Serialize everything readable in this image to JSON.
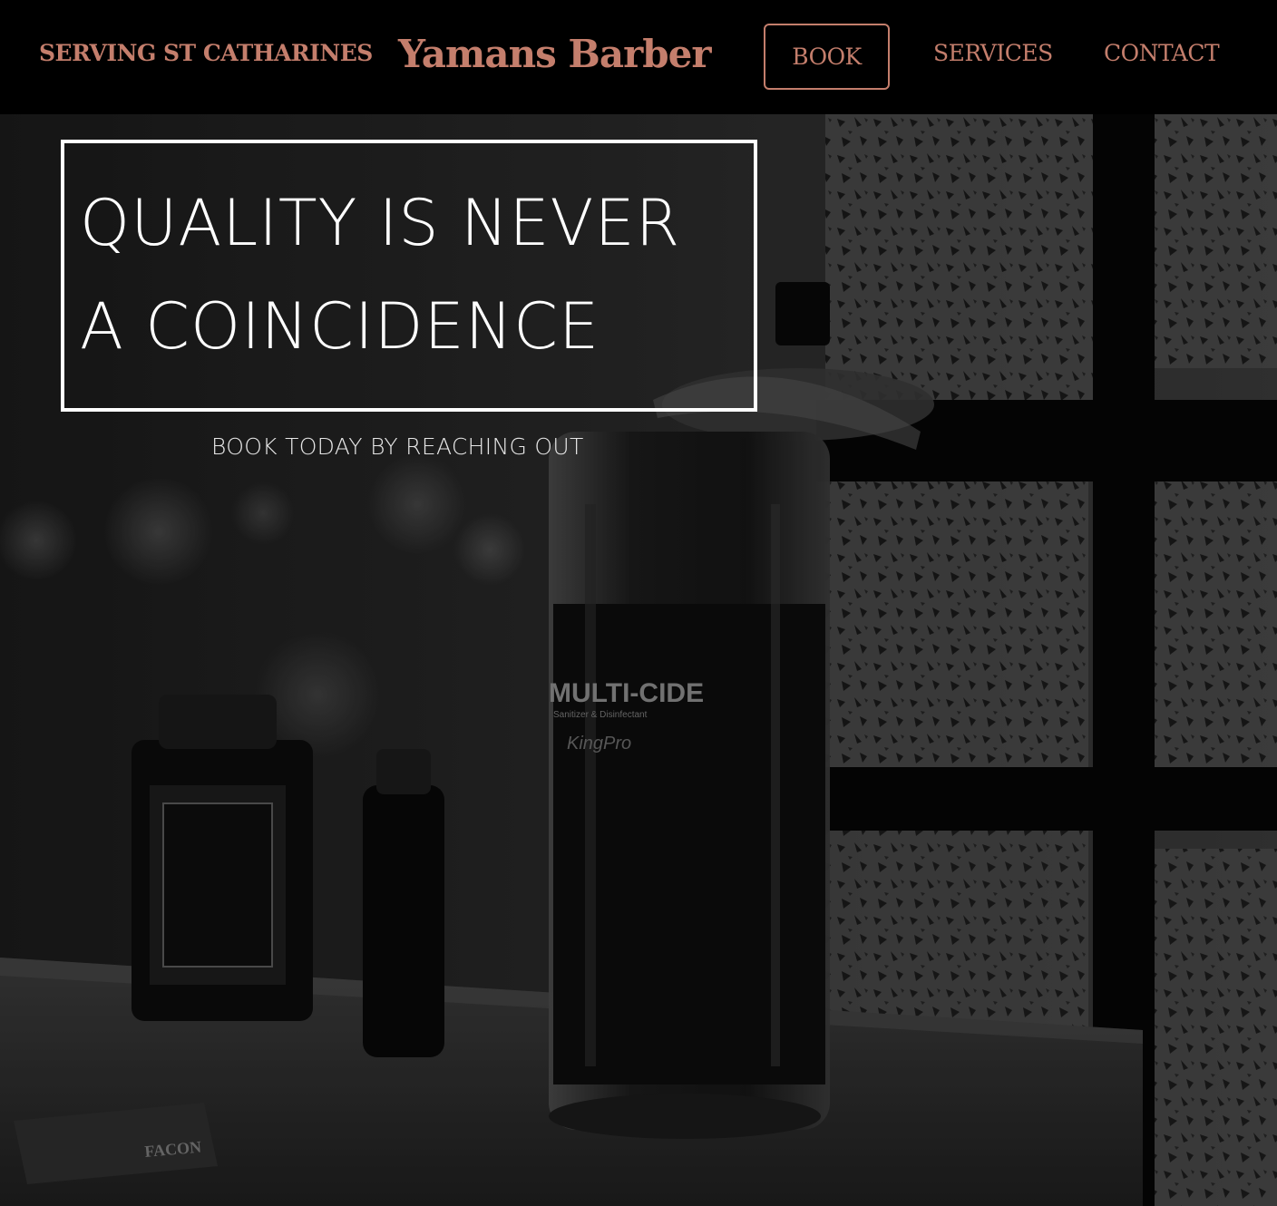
{
  "header": {
    "tagline": "SERVING ST CATHARINES",
    "brand": "Yamans Barber",
    "nav": {
      "book": "BOOK",
      "services": "SERVICES",
      "contact": "CONTACT"
    }
  },
  "hero": {
    "headline_line1": "QUALITY IS NEVER",
    "headline_line2": "A COINCIDENCE",
    "cta": "BOOK TODAY BY REACHING OUT",
    "jar_label": "MULTI-CIDE",
    "jar_sublabel": "Sanitizer & Disinfectant",
    "jar_brand": "KingPro",
    "blade_box": "FACON"
  },
  "colors": {
    "accent": "#c47e6c",
    "header_bg": "#000000",
    "headline_text": "#ffffff"
  }
}
